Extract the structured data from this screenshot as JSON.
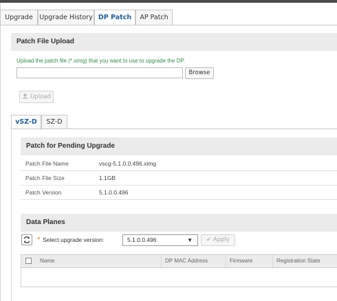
{
  "tabs": [
    "Upgrade",
    "Upgrade History",
    "DP Patch",
    "AP Patch"
  ],
  "active_tab": "DP Patch",
  "upload": {
    "title": "Patch File Upload",
    "hint": "Upload the patch file (*.ximg) that you want to use to upgrade the DP.",
    "file_value": "",
    "browse_label": "Browse",
    "upload_label": "Upload"
  },
  "subtabs": [
    "vSZ-D",
    "SZ-D"
  ],
  "active_subtab": "vSZ-D",
  "pending": {
    "title": "Patch for Pending Upgrade",
    "rows": [
      {
        "label": "Patch File Name",
        "value": "vscg-5.1.0.0.496.ximg"
      },
      {
        "label": "Patch File Size",
        "value": "1.1GB"
      },
      {
        "label": "Patch Version",
        "value": "5.1.0.0.496"
      }
    ]
  },
  "data_planes": {
    "title": "Data Planes",
    "required_mark": "*",
    "select_label": "Select upgrade version:",
    "selected_version": "5.1.0.0.496",
    "apply_label": "Apply",
    "columns": [
      "Name",
      "DP MAC Address",
      "Firmware",
      "Registration State"
    ],
    "rows": []
  },
  "colors": {
    "accent": "#1f5f9c",
    "hint_green": "#2f8f4a",
    "required_orange": "#e07b00",
    "section_bg": "#ebebeb"
  },
  "icons": [
    "upload-icon",
    "refresh-icon",
    "checkmark-icon",
    "caret-down-icon"
  ]
}
